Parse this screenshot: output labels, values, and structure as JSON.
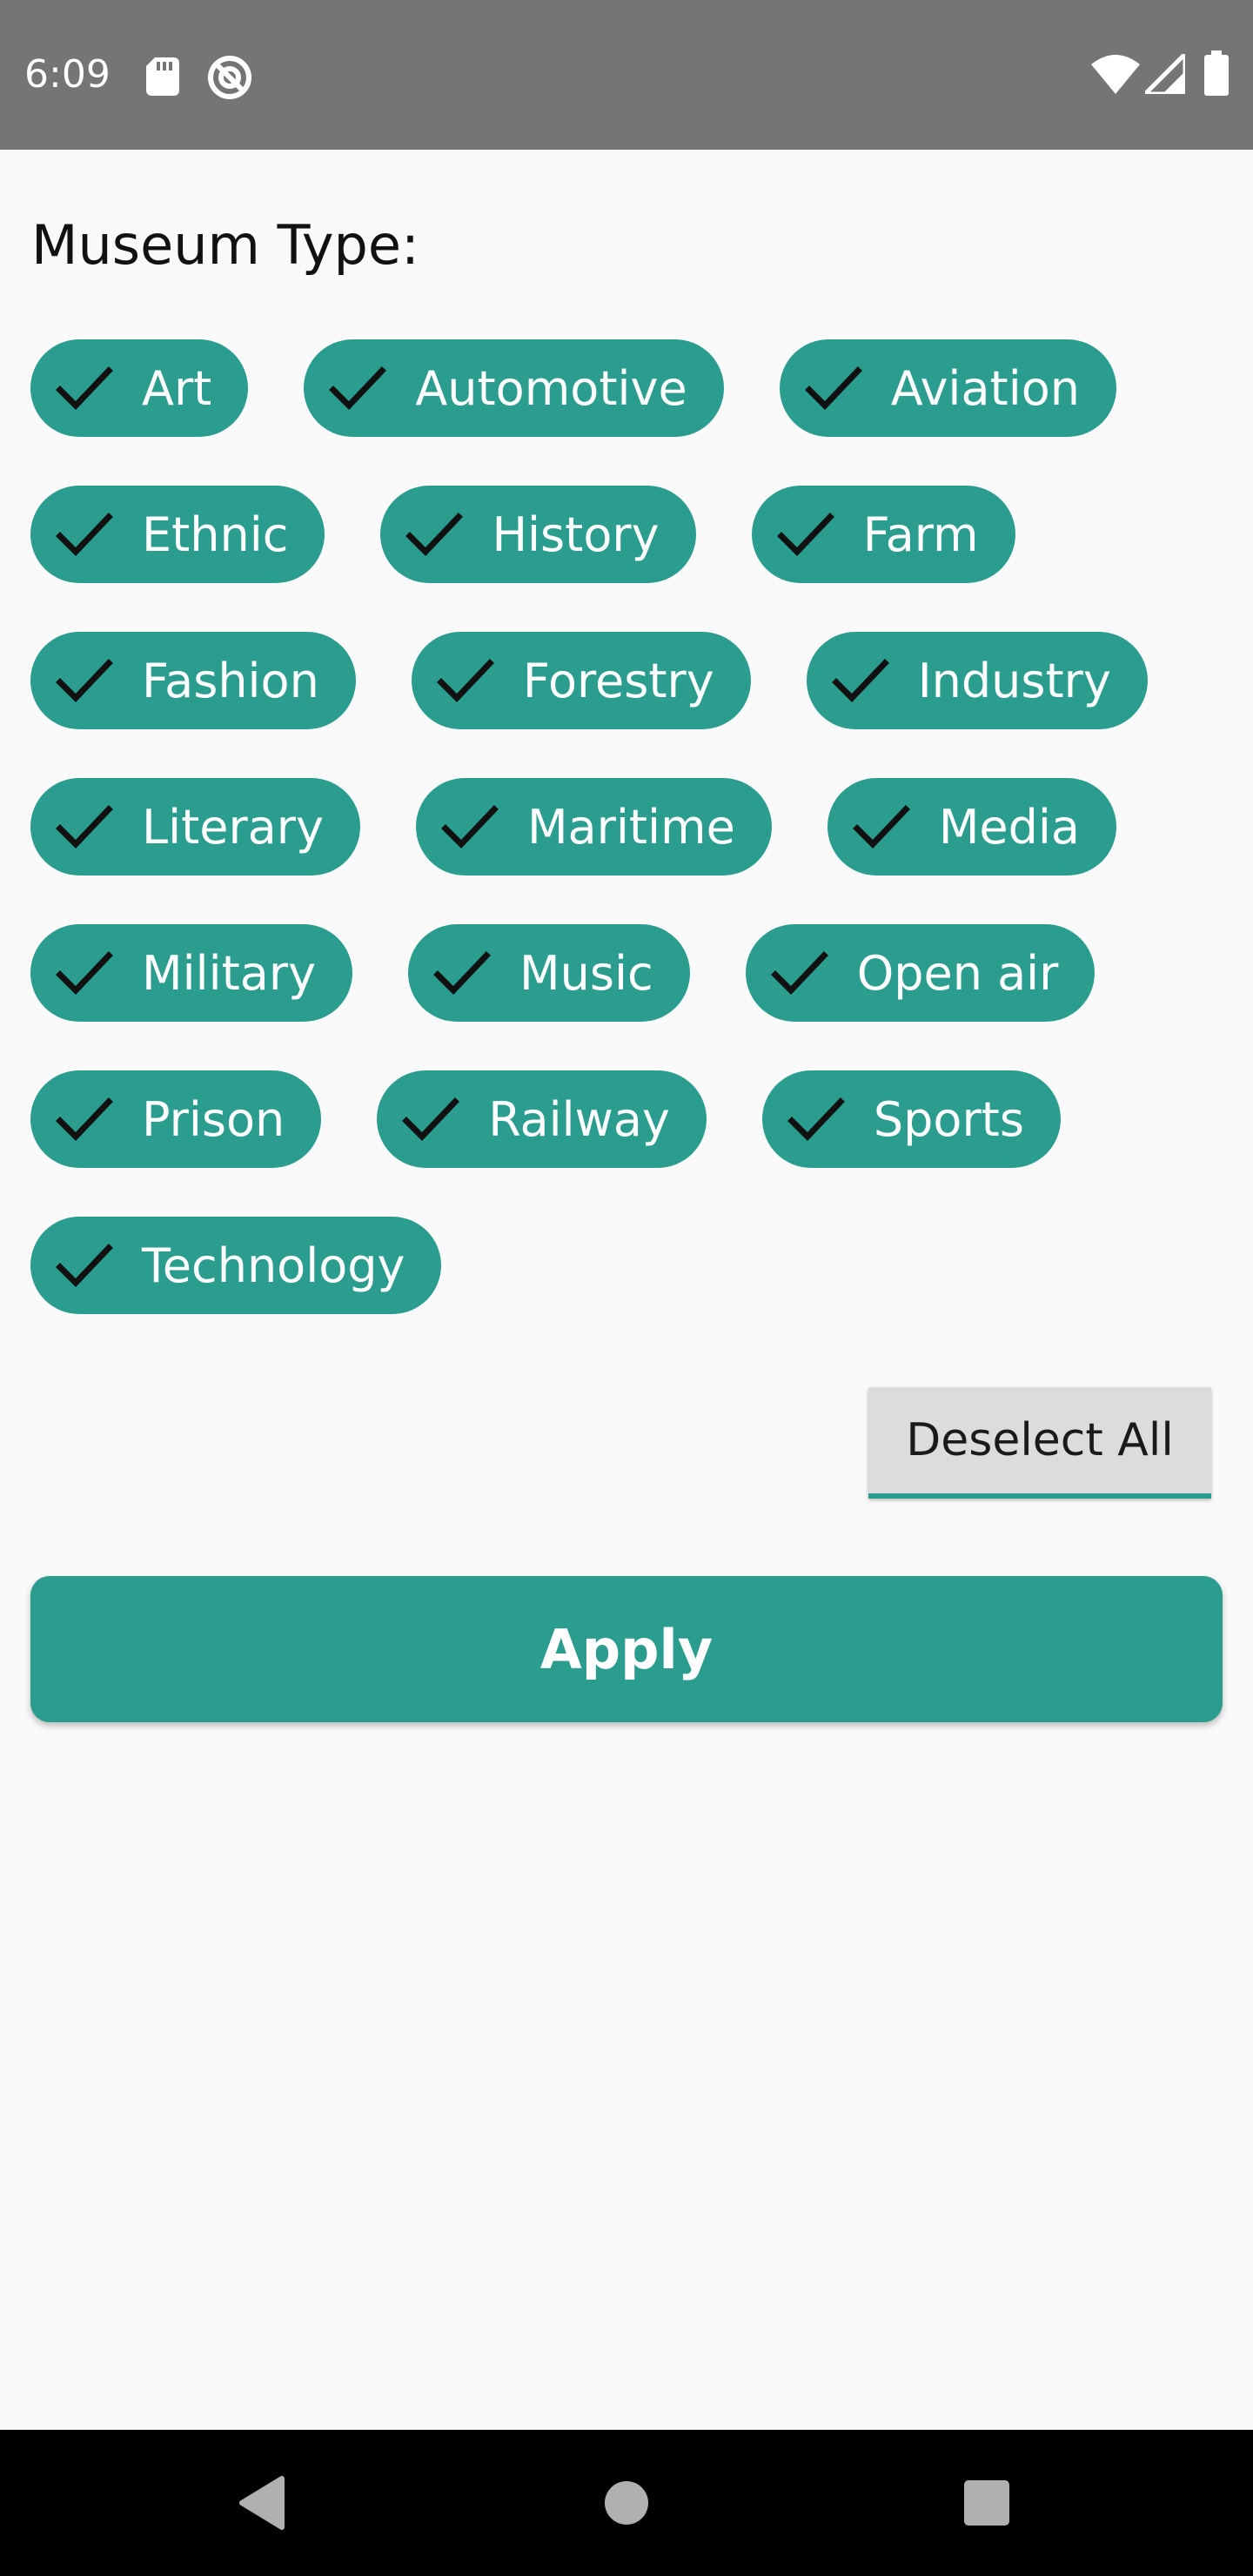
{
  "status_bar": {
    "time": "6:09",
    "icons": [
      "sd-card-icon",
      "do-not-disturb-icon",
      "wifi-icon",
      "cellular-signal-icon",
      "battery-icon"
    ]
  },
  "filter": {
    "title": "Museum Type:",
    "rows": [
      [
        {
          "label": "Art",
          "checked": true
        },
        {
          "label": "Automotive",
          "checked": true
        },
        {
          "label": "Aviation",
          "checked": true
        }
      ],
      [
        {
          "label": "Ethnic",
          "checked": true
        },
        {
          "label": "History",
          "checked": true
        },
        {
          "label": "Farm",
          "checked": true
        }
      ],
      [
        {
          "label": "Fashion",
          "checked": true
        },
        {
          "label": "Forestry",
          "checked": true
        },
        {
          "label": "Industry",
          "checked": true
        }
      ],
      [
        {
          "label": "Literary",
          "checked": true
        },
        {
          "label": "Maritime",
          "checked": true
        },
        {
          "label": "Media",
          "checked": true
        }
      ],
      [
        {
          "label": "Military",
          "checked": true
        },
        {
          "label": "Music",
          "checked": true
        },
        {
          "label": "Open air",
          "checked": true
        }
      ],
      [
        {
          "label": "Prison",
          "checked": true
        },
        {
          "label": "Railway",
          "checked": true
        },
        {
          "label": "Sports",
          "checked": true
        }
      ],
      [
        {
          "label": "Technology",
          "checked": true
        }
      ]
    ],
    "deselect_label": "Deselect All",
    "apply_label": "Apply"
  },
  "nav_bar": {
    "icons": [
      "back-icon",
      "home-icon",
      "recents-icon"
    ]
  },
  "colors": {
    "accent": "#2a9d8f",
    "status_bar": "#757575",
    "background": "#fafafa",
    "nav_bar": "#000000"
  }
}
